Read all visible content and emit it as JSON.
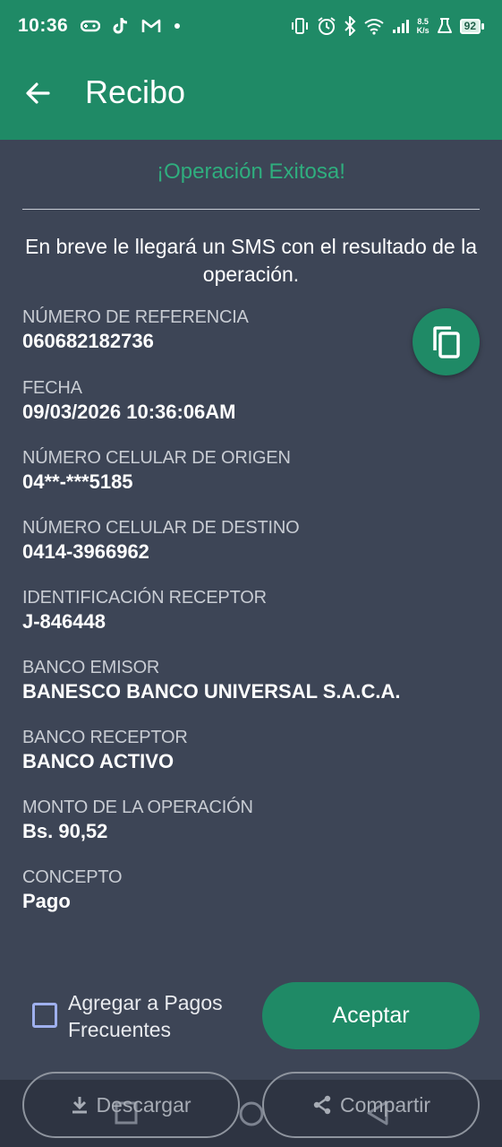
{
  "status_bar": {
    "time": "10:36",
    "speed_value": "8.5",
    "speed_unit": "K/s",
    "battery": "92",
    "icons": [
      "gamepad-icon",
      "tiktok-icon",
      "gmail-icon",
      "dot-icon",
      "vibrate-icon",
      "alarm-icon",
      "bluetooth-icon",
      "wifi-icon",
      "signal-icon",
      "flask-icon",
      "battery-icon"
    ]
  },
  "app_bar": {
    "title": "Recibo",
    "back_icon": "arrow-left-icon"
  },
  "receipt": {
    "status_message": "¡Operación Exitosa!",
    "info": "En breve le llegará un SMS con el resultado de la operación.",
    "fields": [
      {
        "label": "NÚMERO DE REFERENCIA",
        "value": "060682182736"
      },
      {
        "label": "FECHA",
        "value": "09/03/2026 10:36:06AM"
      },
      {
        "label": "NÚMERO CELULAR DE ORIGEN",
        "value": "04**-***5185"
      },
      {
        "label": "NÚMERO CELULAR DE DESTINO",
        "value": "0414-3966962"
      },
      {
        "label": "IDENTIFICACIÓN RECEPTOR",
        "value": "J-846448"
      },
      {
        "label": "BANCO EMISOR",
        "value": "BANESCO BANCO UNIVERSAL S.A.C.A."
      },
      {
        "label": "BANCO RECEPTOR",
        "value": "BANCO ACTIVO"
      },
      {
        "label": "MONTO DE LA OPERACIÓN",
        "value": "Bs. 90,52"
      },
      {
        "label": "CONCEPTO",
        "value": "Pago"
      }
    ],
    "copy_icon": "copy-icon"
  },
  "actions": {
    "frequent_checkbox_label": "Agregar a Pagos Frecuentes",
    "frequent_checked": false,
    "accept_label": "Aceptar",
    "download_label": "Descargar",
    "share_label": "Compartir"
  },
  "colors": {
    "brand_green": "#1f8a66",
    "success_text": "#2fae7e",
    "background": "#3d4556"
  }
}
